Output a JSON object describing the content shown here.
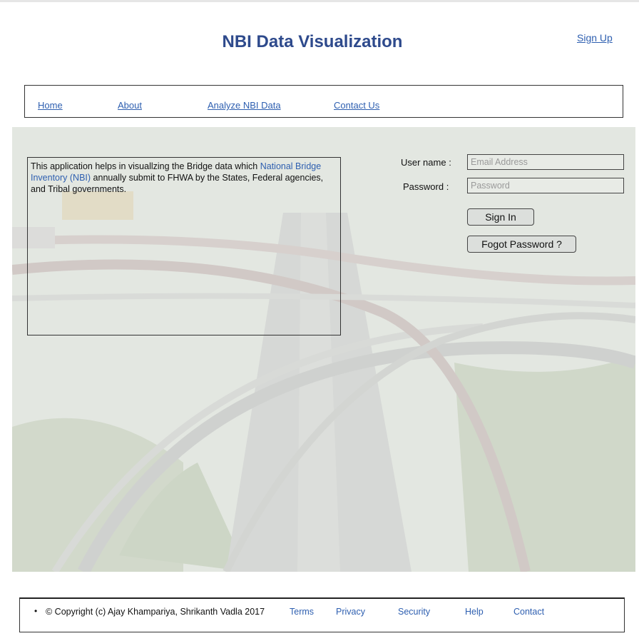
{
  "header": {
    "title": "NBI Data Visualization",
    "signup_label": "Sign Up"
  },
  "nav": {
    "items": [
      {
        "label": "Home"
      },
      {
        "label": "About"
      },
      {
        "label": "Analyze NBI Data"
      },
      {
        "label": "Contact Us"
      }
    ]
  },
  "info": {
    "text_before": " This application helps in visuallzing the Bridge data which ",
    "highlight": "National Bridge Inventory (NBI)",
    "text_after": "  annually submit to FHWA by the States, Federal agencies, and Tribal governments."
  },
  "login": {
    "username_label": "User name :",
    "username_placeholder": "Email Address",
    "username_value": "",
    "password_label": "Password :",
    "password_placeholder": "Password",
    "password_value": "",
    "signin_label": "Sign In",
    "forgot_label": "Fogot Password ?"
  },
  "footer": {
    "copyright": "©   Copyright (c) Ajay Khampariya, Shrikanth Vadla 2017",
    "links": [
      {
        "label": "Terms"
      },
      {
        "label": "Privacy"
      },
      {
        "label": "Security"
      },
      {
        "label": "Help"
      },
      {
        "label": "Contact"
      }
    ]
  },
  "colors": {
    "title": "#2e4a8c",
    "link": "#2e5fb0",
    "border": "#333333"
  }
}
